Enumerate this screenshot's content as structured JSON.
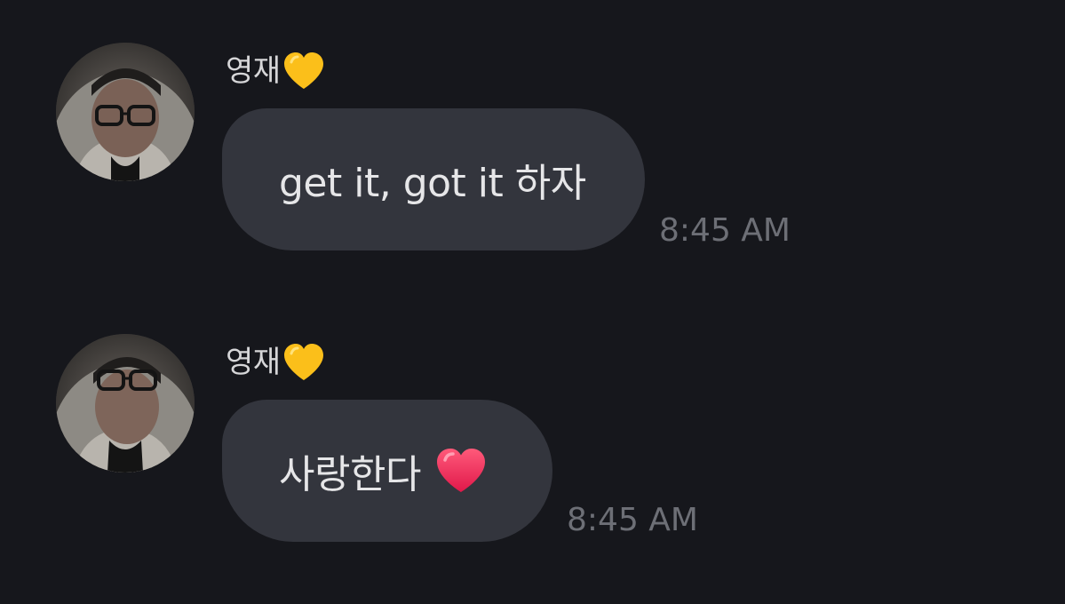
{
  "messages": [
    {
      "sender": "영재",
      "sender_emoji": "yellow-heart-emoji",
      "text": "get it, got it 하자",
      "trailing_emoji": "",
      "time": "8:45 AM"
    },
    {
      "sender": "영재",
      "sender_emoji": "yellow-heart-emoji",
      "text": "사랑한다",
      "trailing_emoji": "red-heart-emoji",
      "time": "8:45 AM"
    }
  ],
  "colors": {
    "background": "#16171c",
    "bubble": "#33353d",
    "text": "#e6e6e8",
    "sender": "#d6d6d8",
    "timestamp": "#6d6f76",
    "yellow_heart": "#fbbf1a",
    "red_heart": "#f5365c"
  }
}
